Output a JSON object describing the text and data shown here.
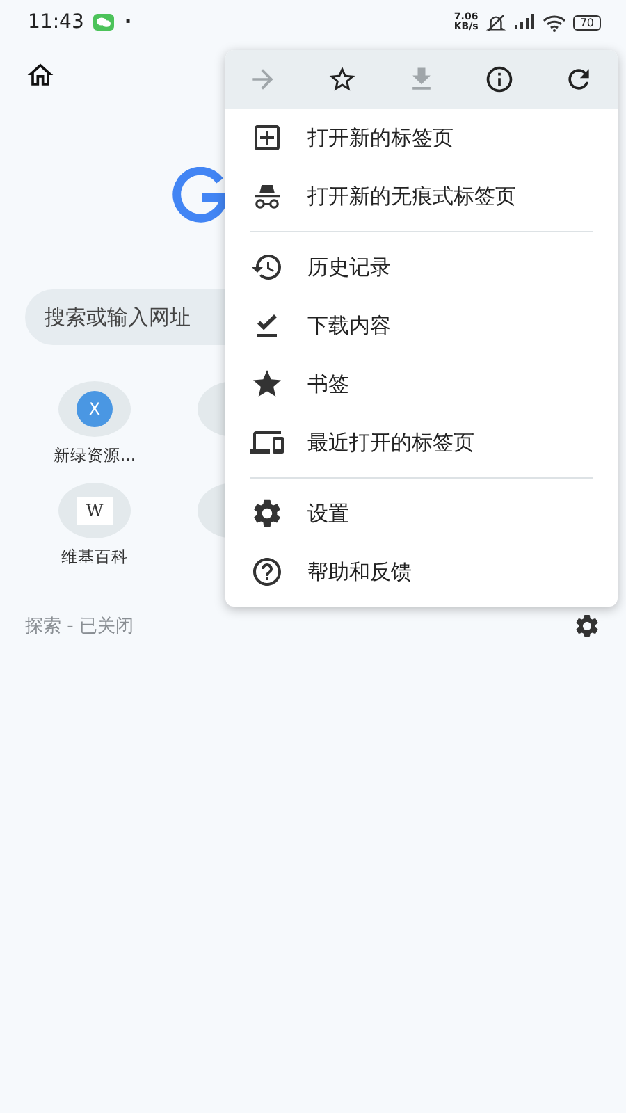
{
  "status_bar": {
    "time": "11:43",
    "dot": "·",
    "speed_value": "7.06",
    "speed_unit": "KB/s",
    "battery": "70"
  },
  "search": {
    "placeholder": "搜索或输入网址"
  },
  "shortcuts": [
    {
      "kind": "letter",
      "icon_text": "X",
      "label": "新绿资源..."
    },
    {
      "kind": "blank"
    },
    {
      "kind": "wiki",
      "icon_text": "W",
      "label": "维基百科"
    },
    {
      "kind": "blank"
    }
  ],
  "discover": {
    "text": "探索 - 已关闭"
  },
  "menu": {
    "actions": [
      {
        "kind": "forward",
        "disabled": true
      },
      {
        "kind": "bookmark",
        "disabled": false
      },
      {
        "kind": "download",
        "disabled": true
      },
      {
        "kind": "info",
        "disabled": false
      },
      {
        "kind": "refresh",
        "disabled": false
      }
    ],
    "groups": [
      [
        {
          "kind": "new-tab",
          "label": "打开新的标签页"
        },
        {
          "kind": "incognito",
          "label": "打开新的无痕式标签页"
        }
      ],
      [
        {
          "kind": "history",
          "label": "历史记录"
        },
        {
          "kind": "downloads",
          "label": "下载内容"
        },
        {
          "kind": "bookmarks",
          "label": "书签"
        },
        {
          "kind": "recent-tabs",
          "label": "最近打开的标签页"
        }
      ],
      [
        {
          "kind": "settings",
          "label": "设置"
        },
        {
          "kind": "help",
          "label": "帮助和反馈"
        }
      ]
    ]
  }
}
